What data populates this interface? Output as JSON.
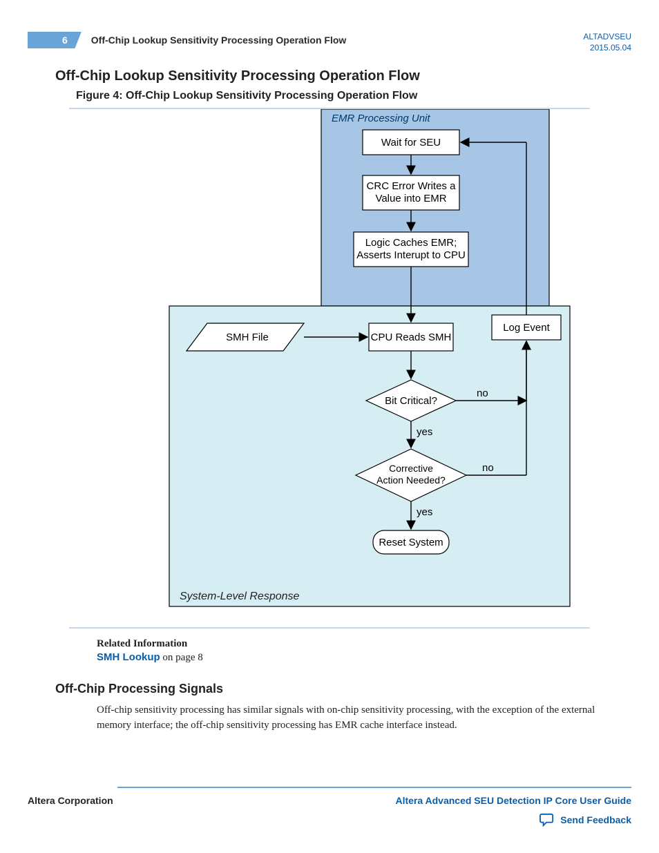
{
  "header": {
    "page_number": "6",
    "running_title": "Off-Chip Lookup Sensitivity Processing Operation Flow",
    "doc_code": "ALTADVSEU",
    "doc_date": "2015.05.04"
  },
  "titles": {
    "section": "Off-Chip Lookup Sensitivity Processing Operation Flow",
    "figure_caption": "Figure 4: Off-Chip Lookup Sensitivity Processing Operation Flow",
    "section2": "Off-Chip Processing Signals"
  },
  "diagram": {
    "outer_label": "EMR Processing Unit",
    "inner_label": "System-Level Response",
    "boxes": {
      "wait": "Wait for SEU",
      "crc1": "CRC Error Writes a",
      "crc2": "Value into EMR",
      "logic1": "Logic Caches EMR;",
      "logic2": "Asserts Interupt to CPU",
      "smh": "SMH File",
      "cpu": "CPU Reads SMH",
      "log": "Log Event",
      "bit": "Bit Critical?",
      "corr1": "Corrective",
      "corr2": "Action Needed?",
      "reset": "Reset System"
    },
    "labels": {
      "yes": "yes",
      "no": "no"
    }
  },
  "related": {
    "heading": "Related Information",
    "link_text": "SMH Lookup",
    "link_suffix": " on page 8"
  },
  "body_text": "Off-chip sensitivity processing has similar signals with on-chip sensitivity processing, with the exception of the external memory interface; the off-chip sensitivity processing has EMR cache interface instead.",
  "footer": {
    "left": "Altera Corporation",
    "right": "Altera Advanced SEU Detection IP Core User Guide",
    "feedback": "Send Feedback"
  }
}
